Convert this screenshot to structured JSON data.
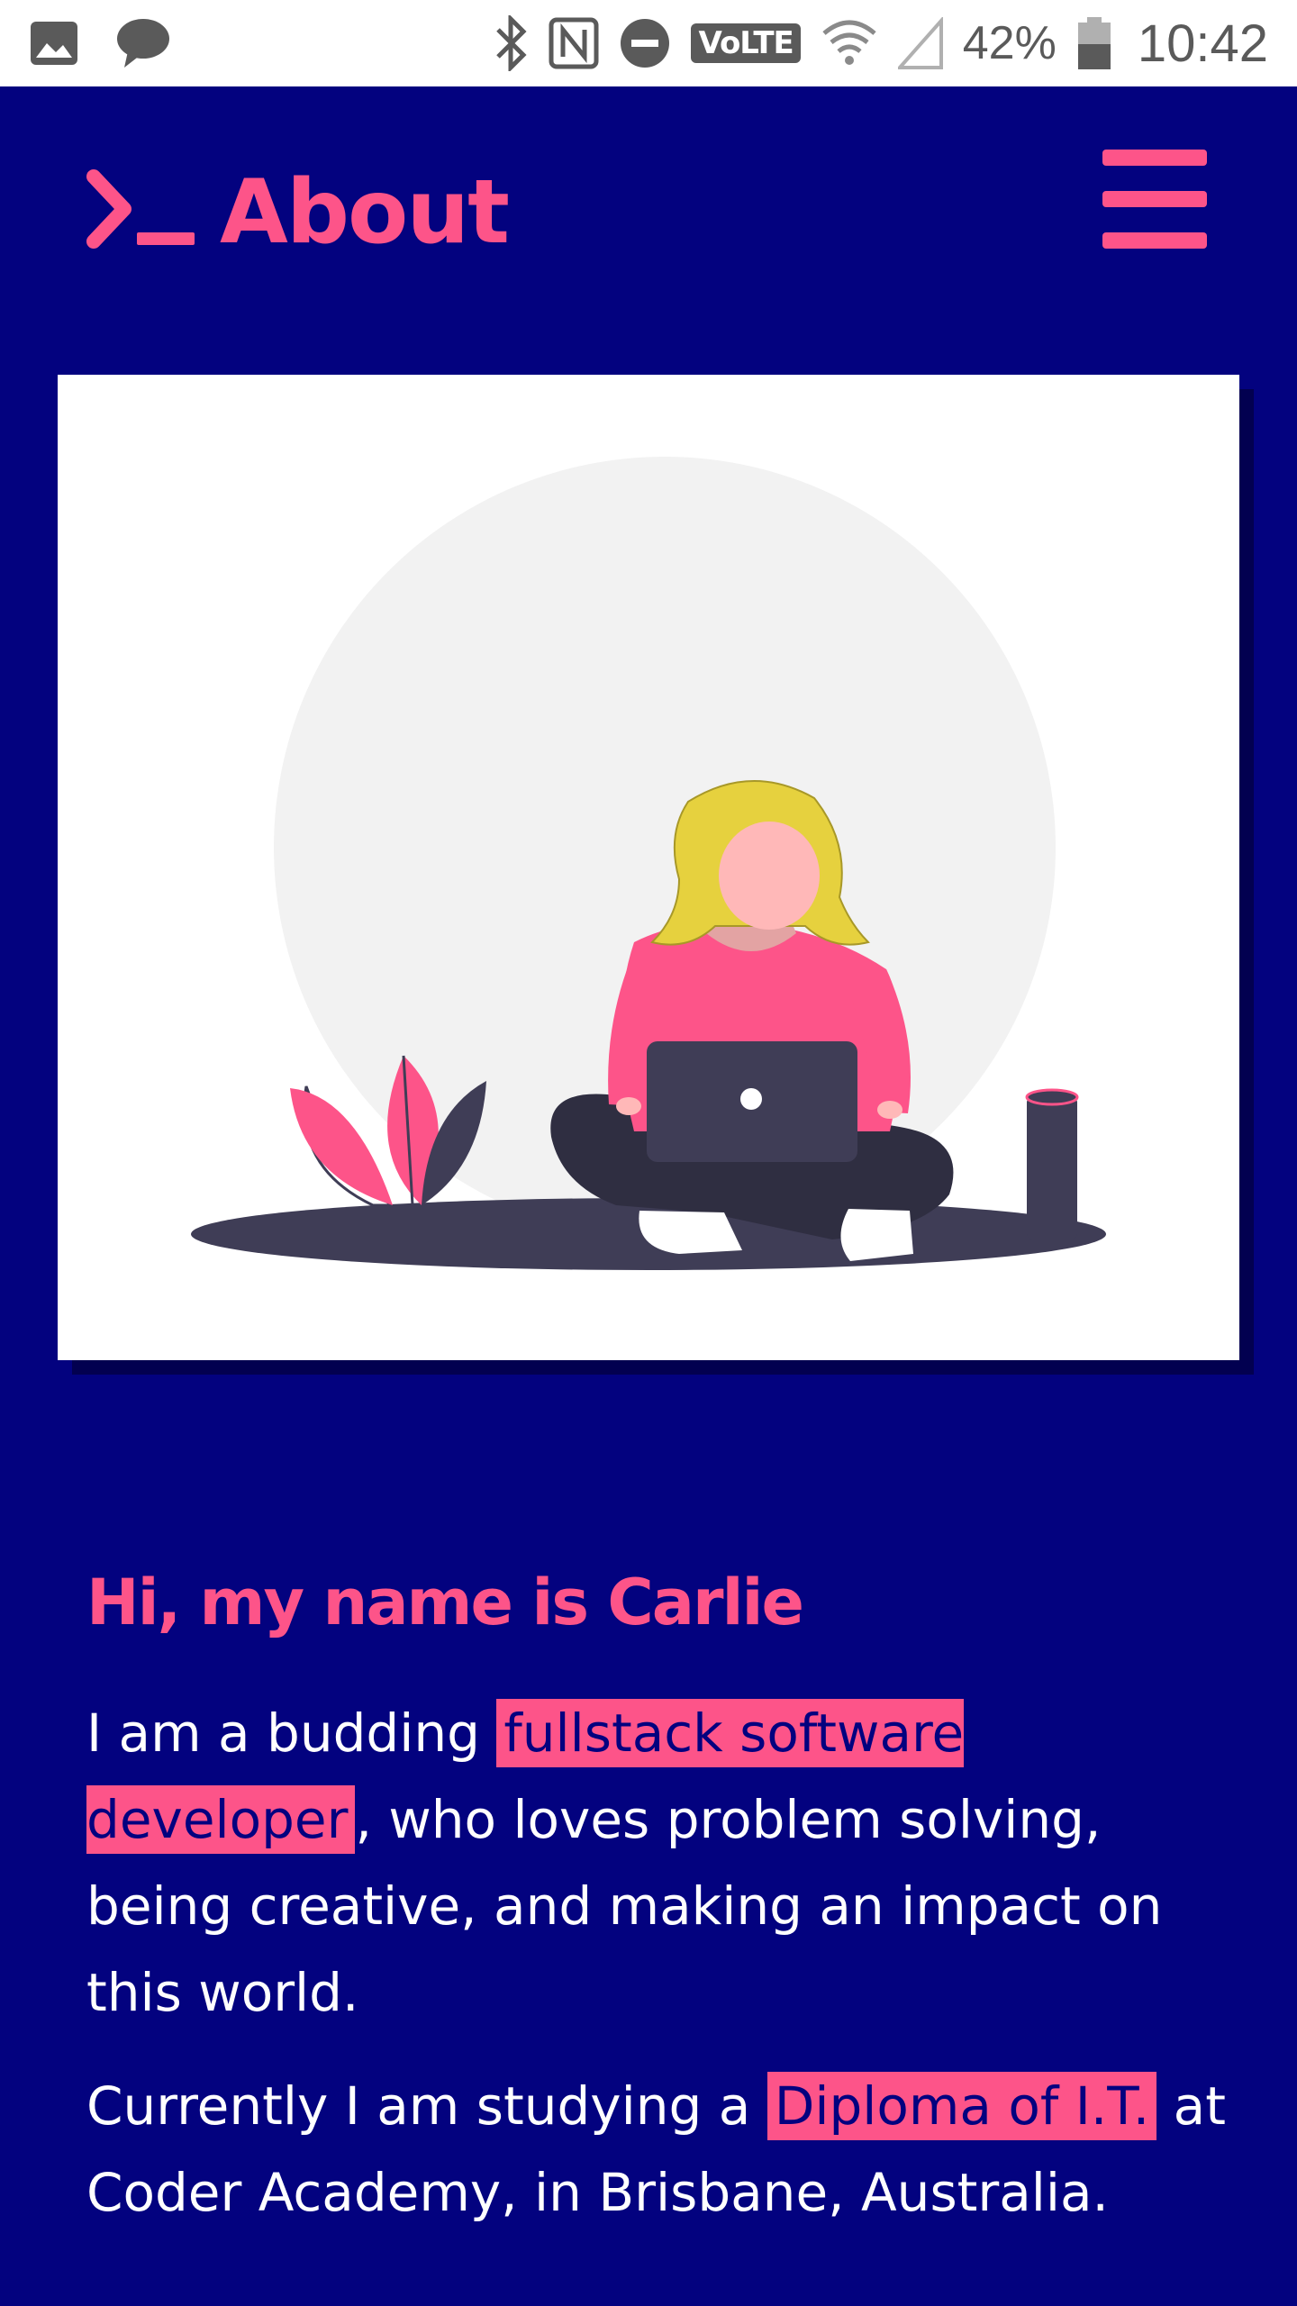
{
  "status_bar": {
    "icons": [
      "image-icon",
      "chat-bubble-icon",
      "bluetooth-icon",
      "nfc-icon",
      "do-not-disturb-icon",
      "wifi-icon",
      "cell-signal-icon",
      "battery-icon"
    ],
    "volte": "VoLTE",
    "battery_percent": "42%",
    "time": "10:42"
  },
  "header": {
    "title": "About",
    "logo_icon": "terminal-prompt-icon",
    "menu_icon": "hamburger-menu-icon"
  },
  "illustration": {
    "icon": "woman-with-laptop-illustration",
    "colors": {
      "background_circle": "#f2f2f2",
      "shirt": "#fd5489",
      "hair": "#e6d13e",
      "skin": "#ffb8b8",
      "dark": "#3f3d56"
    }
  },
  "about": {
    "greeting": "Hi, my name is Carlie",
    "para1": {
      "before": "I am a budding ",
      "highlight": "fullstack software developer",
      "after": ", who loves problem solving, being creative, and making an impact on this world."
    },
    "para2": {
      "before": "Currently I am studying a ",
      "highlight": "Diploma of I.T.",
      "after": " at Coder Academy, in Brisbane, Australia."
    }
  },
  "colors": {
    "background": "#03027f",
    "accent": "#fd5489",
    "text": "#ffffff"
  }
}
